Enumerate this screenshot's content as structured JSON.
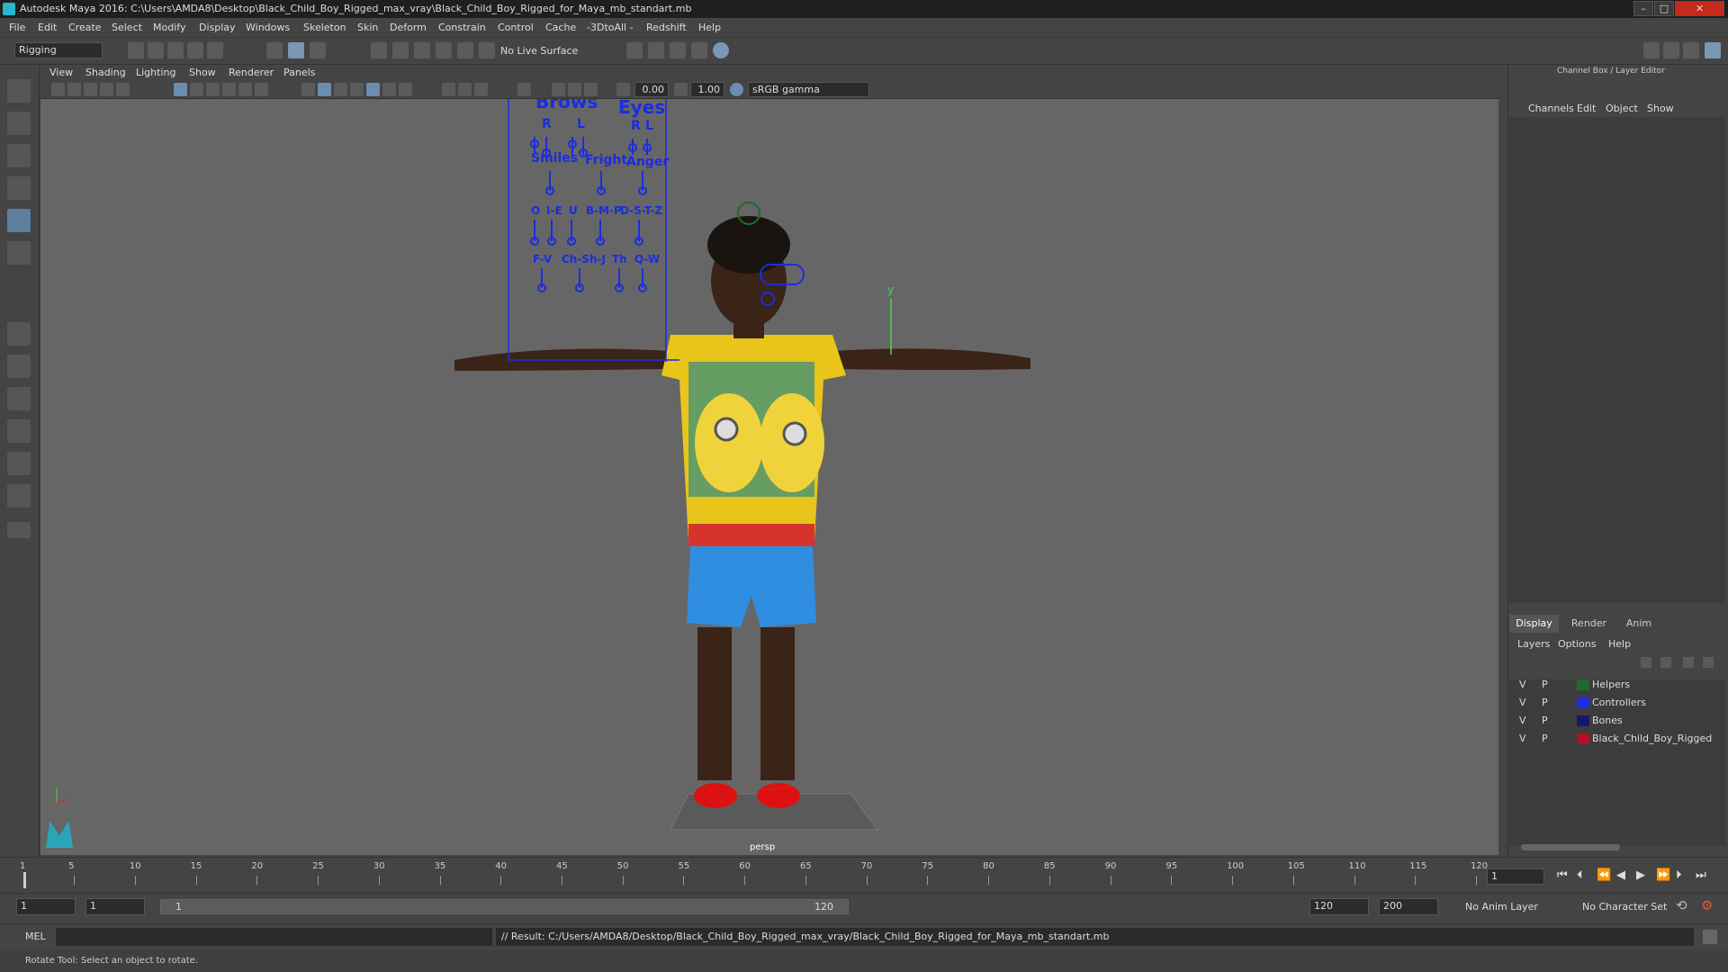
{
  "window": {
    "title": "Autodesk Maya 2016: C:\\Users\\AMDA8\\Desktop\\Black_Child_Boy_Rigged_max_vray\\Black_Child_Boy_Rigged_for_Maya_mb_standart.mb"
  },
  "menubar": {
    "items": [
      "File",
      "Edit",
      "Create",
      "Select",
      "Modify",
      "Display",
      "Windows",
      "Skeleton",
      "Skin",
      "Deform",
      "Constrain",
      "Control",
      "Cache",
      "-3DtoAll -",
      "Redshift",
      "Help"
    ]
  },
  "toolbar": {
    "mode": "Rigging",
    "live_surface": "No Live Surface"
  },
  "viewport": {
    "menu": [
      "View",
      "Shading",
      "Lighting",
      "Show",
      "Renderer",
      "Panels"
    ],
    "exposure": "0.00",
    "gamma": "1.00",
    "color_space": "sRGB gamma",
    "camera": "persp",
    "axis_y": "y",
    "face_controls": {
      "brows": "Brows",
      "eyes": "Eyes",
      "r": "R",
      "l": "L",
      "smiles": "Smiles",
      "fright": "Fright",
      "anger": "Anger",
      "o": "O",
      "ie": "I-E",
      "u": "U",
      "bmp": "B-M-P",
      "dstz": "D-S-T-Z",
      "fv": "F-V",
      "chshj": "Ch-Sh-J",
      "th": "Th",
      "qw": "Q-W"
    }
  },
  "channel_box": {
    "title": "Channel Box / Layer Editor",
    "menu": [
      "Channels",
      "Edit",
      "Object",
      "Show"
    ]
  },
  "layer_editor": {
    "tabs": [
      "Display",
      "Render",
      "Anim"
    ],
    "active_tab": "Display",
    "menu": [
      "Layers",
      "Options",
      "Help"
    ],
    "layers": [
      {
        "v": "V",
        "p": "P",
        "name": "Helpers",
        "color": "#1e6b2a"
      },
      {
        "v": "V",
        "p": "P",
        "name": "Controllers",
        "color": "#1a2de0"
      },
      {
        "v": "V",
        "p": "P",
        "name": "Bones",
        "color": "#101a6b"
      },
      {
        "v": "V",
        "p": "P",
        "name": "Black_Child_Boy_Rigged",
        "color": "#b0102a"
      }
    ]
  },
  "timeline": {
    "ticks": [
      "1",
      "5",
      "10",
      "15",
      "20",
      "25",
      "30",
      "35",
      "40",
      "45",
      "50",
      "55",
      "60",
      "65",
      "70",
      "75",
      "80",
      "85",
      "90",
      "95",
      "100",
      "105",
      "110",
      "115",
      "120"
    ],
    "current_frame": "1"
  },
  "range": {
    "start": "1",
    "playback_start": "1",
    "slider_start": "1",
    "slider_end": "120",
    "playback_end": "120",
    "end": "200",
    "anim_layer": "No Anim Layer",
    "character_set": "No Character Set"
  },
  "command": {
    "lang": "MEL",
    "result": "// Result: C:/Users/AMDA8/Desktop/Black_Child_Boy_Rigged_max_vray/Black_Child_Boy_Rigged_for_Maya_mb_standart.mb"
  },
  "status": {
    "help": "Rotate Tool: Select an object to rotate."
  }
}
